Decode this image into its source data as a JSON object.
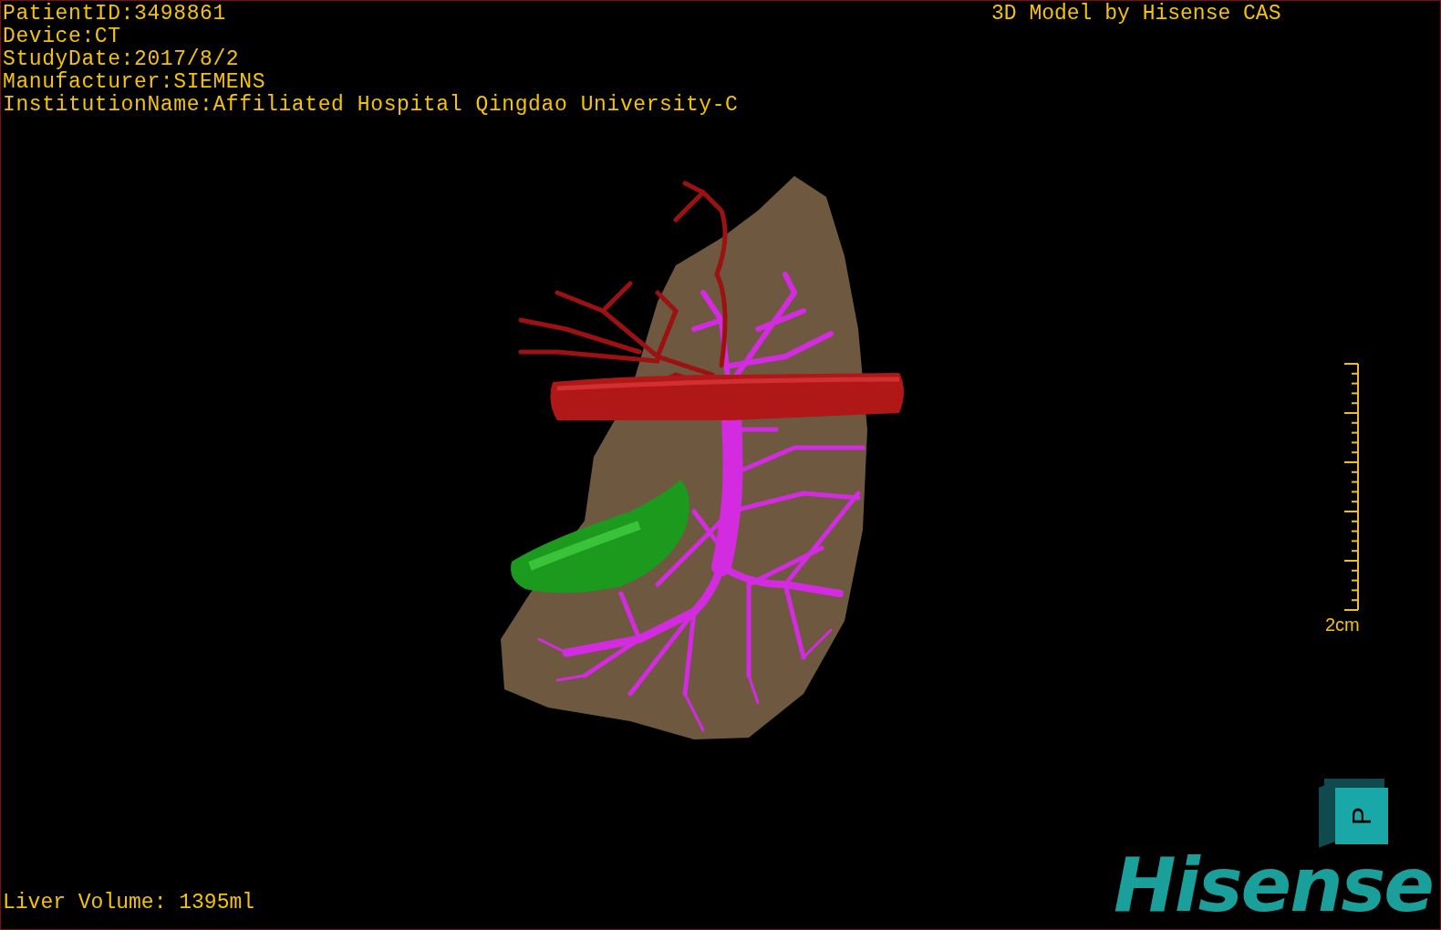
{
  "patient_info": [
    "PatientID:3498861",
    "Device:CT",
    "StudyDate:2017/8/2",
    "Manufacturer:SIEMENS",
    "InstitutionName:Affiliated Hospital Qingdao University-C"
  ],
  "model_credit": "3D Model by Hisense CAS",
  "scale_bar": {
    "label": "2cm"
  },
  "orientation_cube": {
    "face_label": "P"
  },
  "logo": "Hisense",
  "liver_volume": "Liver Volume: 1395ml"
}
